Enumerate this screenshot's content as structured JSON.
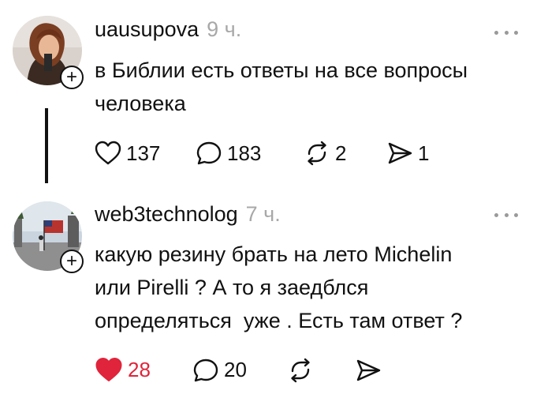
{
  "posts": [
    {
      "username": "uausupova",
      "time": "9 ч.",
      "lines": [
        "в Библии есть ответы на все вопросы",
        "человека"
      ],
      "likes": "137",
      "comments": "183",
      "reposts": "2",
      "shares": "1",
      "liked": false
    },
    {
      "username": "web3technolog",
      "time": "7 ч.",
      "lines": [
        "какую резину брать на лето Michelin",
        "или Pirelli ? А то я заедблся",
        "определяться  уже . Есть там ответ ?"
      ],
      "likes": "28",
      "comments": "20",
      "reposts": "",
      "shares": "",
      "liked": true
    }
  ],
  "icons": {
    "heart": "heart-icon",
    "comment": "comment-icon",
    "repost": "repost-icon",
    "share": "share-icon",
    "more": "more-icon",
    "follow": "plus-icon"
  },
  "colors": {
    "like_active": "#e0243b",
    "timestamp": "#a8a8a8",
    "text": "#111111"
  },
  "follow_symbol": "+"
}
